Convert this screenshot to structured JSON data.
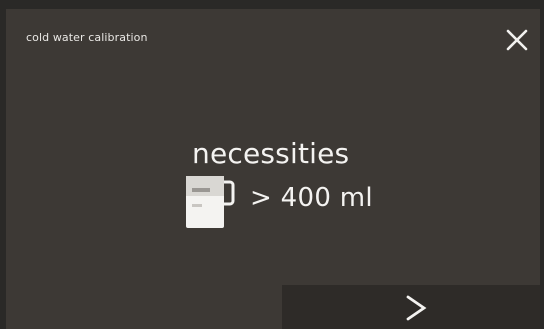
{
  "header": {
    "title": "cold water calibration",
    "close_icon": "close-icon"
  },
  "main": {
    "heading": "necessities",
    "requirement": {
      "icon": "measuring-jug-icon",
      "value": "> 400 ml"
    }
  },
  "footer": {
    "next_icon": "chevron-right-icon"
  },
  "colors": {
    "background": "#3d3935",
    "next_button_background": "#2e2b28",
    "text": "#f2f1ef"
  }
}
